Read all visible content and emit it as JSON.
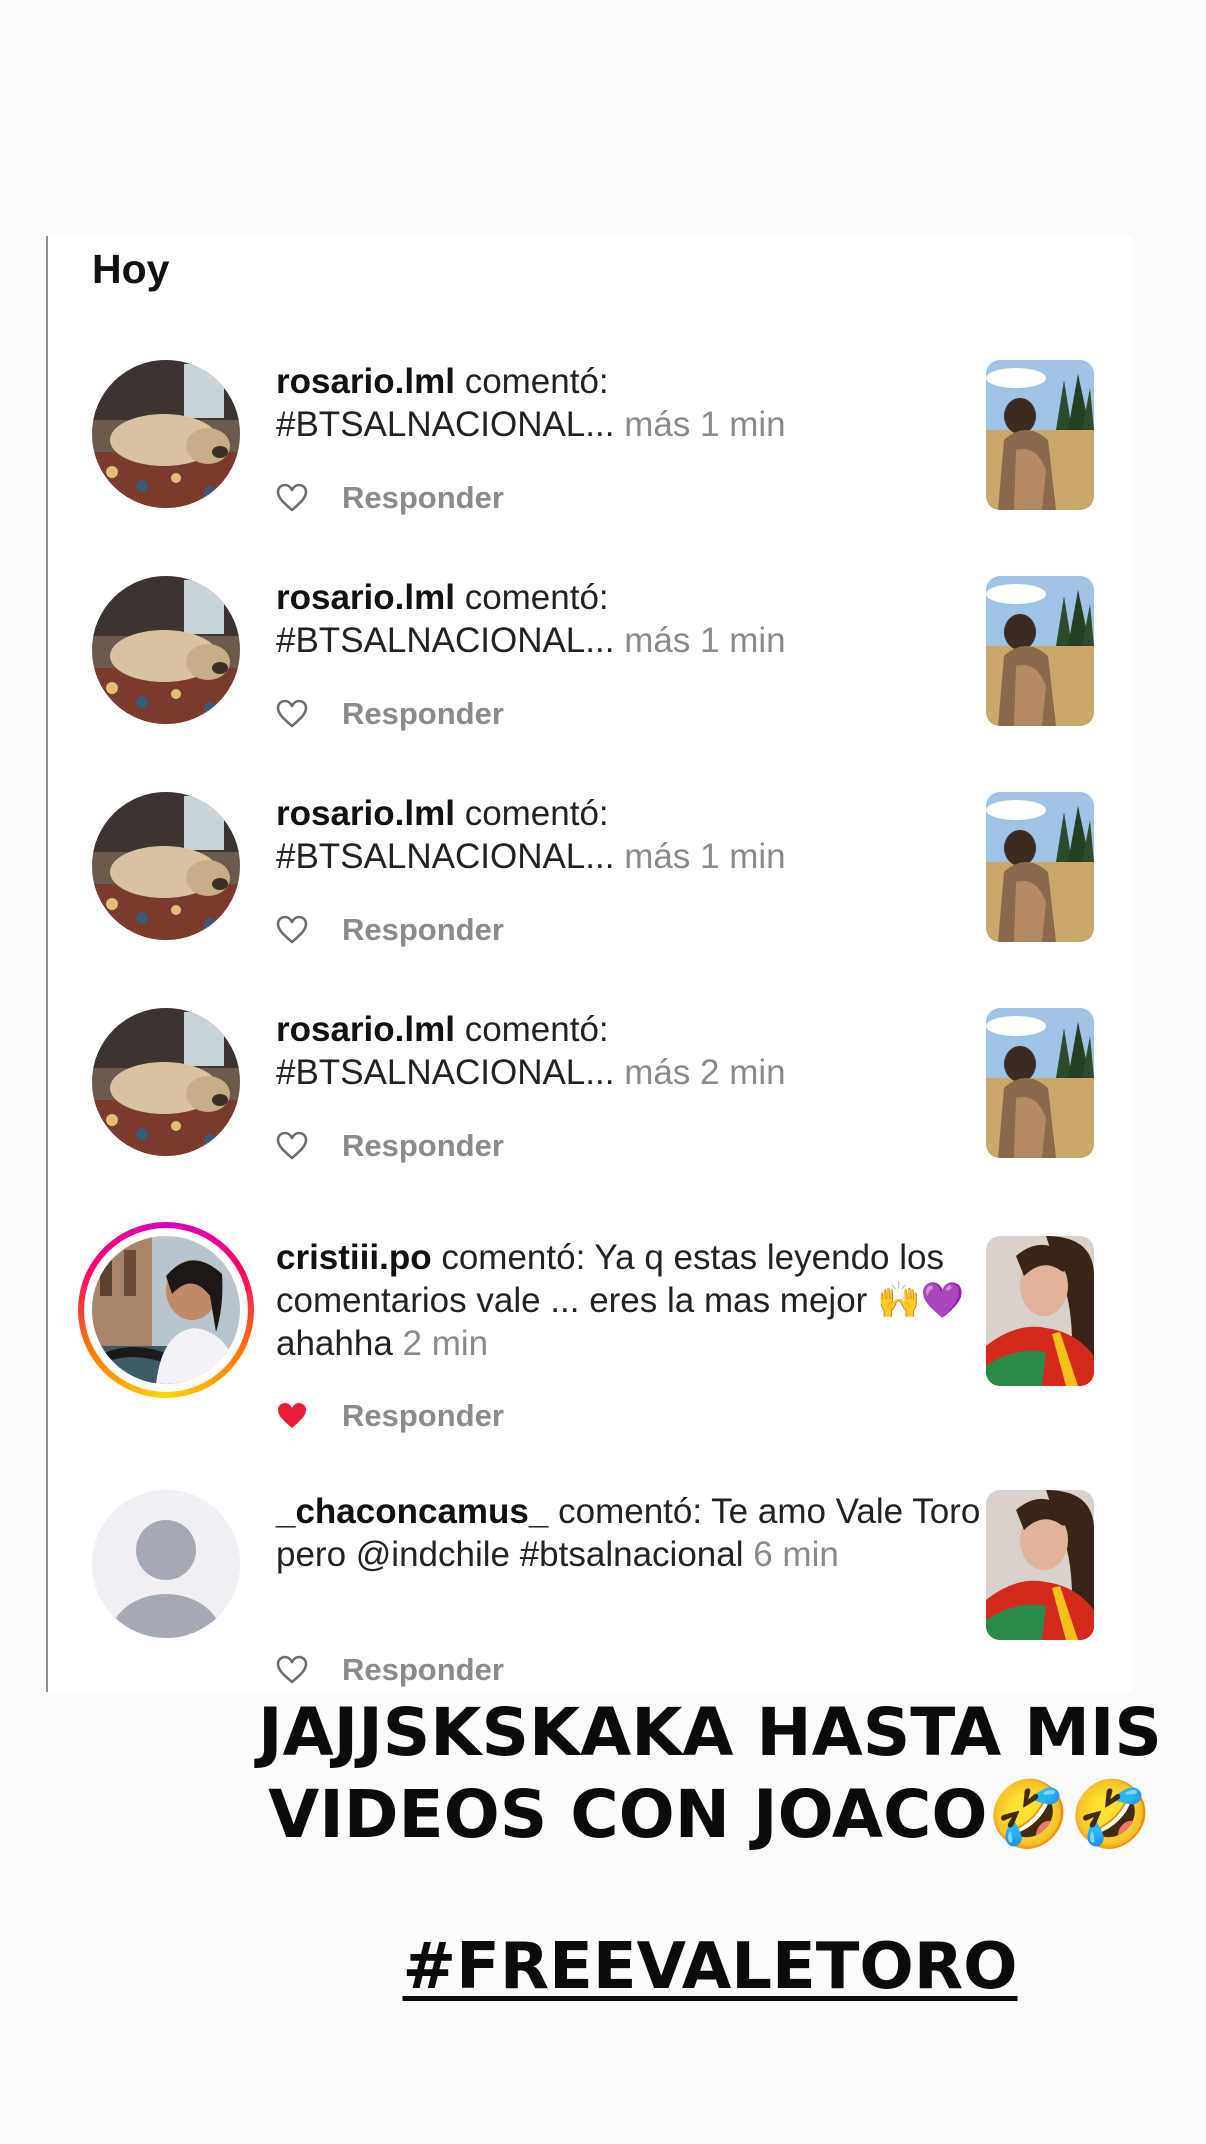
{
  "section": {
    "title": "Hoy"
  },
  "notifications": [
    {
      "username": "rosario.lml",
      "action": "comentó:",
      "text": "#BTSALNACIONAL...",
      "time": "más 1 min",
      "reply_label": "Responder",
      "liked": false,
      "avatar_icon": "dog-photo-avatar",
      "thumbnail_icon": "outdoor-photo-thumbnail"
    },
    {
      "username": "rosario.lml",
      "action": "comentó:",
      "text": "#BTSALNACIONAL...",
      "time": "más 1 min",
      "reply_label": "Responder",
      "liked": false,
      "avatar_icon": "dog-photo-avatar",
      "thumbnail_icon": "outdoor-photo-thumbnail"
    },
    {
      "username": "rosario.lml",
      "action": "comentó:",
      "text": "#BTSALNACIONAL...",
      "time": "más 1 min",
      "reply_label": "Responder",
      "liked": false,
      "avatar_icon": "dog-photo-avatar",
      "thumbnail_icon": "outdoor-photo-thumbnail"
    },
    {
      "username": "rosario.lml",
      "action": "comentó:",
      "text": "#BTSALNACIONAL...",
      "time": "más 2 min",
      "reply_label": "Responder",
      "liked": false,
      "avatar_icon": "dog-photo-avatar",
      "thumbnail_icon": "outdoor-photo-thumbnail"
    },
    {
      "username": "cristiii.po",
      "action": "comentó:",
      "text": "Ya q estas leyendo los comentarios vale ... eres la mas mejor 🙌💜 ahahha",
      "time": "2 min",
      "reply_label": "Responder",
      "liked": true,
      "has_story_ring": true,
      "avatar_icon": "woman-photo-avatar",
      "thumbnail_icon": "video-thumbnail"
    },
    {
      "username": "_chaconcamus_",
      "action": "comentó:",
      "text": "Te amo Vale Toro pero @indchile #btsalnacional",
      "time": "6 min",
      "reply_label": "Responder",
      "liked": false,
      "avatar_icon": "default-user-avatar",
      "thumbnail_icon": "video-thumbnail"
    }
  ],
  "overlay": {
    "caption": "JAJJSKSKAKA HASTA MIS VIDEOS CON JOACO🤣🤣",
    "hashtag": "#FREEVALETORO"
  },
  "colors": {
    "liked_heart": "#ed1c3a",
    "meta_gray": "#8a8a8a",
    "story_ring": [
      "#d300c5",
      "#ff0069",
      "#ff7a00",
      "#ffd600"
    ]
  }
}
